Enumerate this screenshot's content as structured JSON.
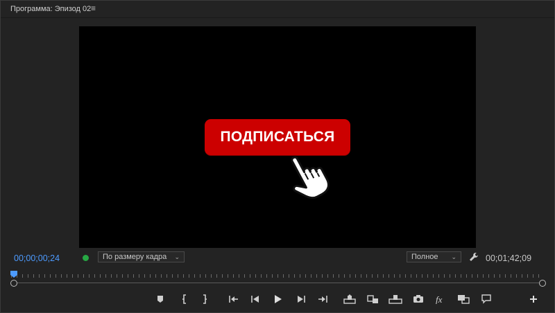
{
  "panel": {
    "title": "Программа: Эпизод 02",
    "menu_icon": "hamburger-menu-icon"
  },
  "viewer": {
    "subscribe_label": "ПОДПИСАТЬСЯ",
    "subscribe_color": "#cc0000",
    "pointer_icon": "hand-pointer-icon"
  },
  "status": {
    "current_timecode": "00;00;00;24",
    "current_timecode_color": "#4d9bff",
    "duration_timecode": "00;01;42;09",
    "fit_dropdown": "По размеру кадра",
    "resolution_dropdown": "Полное",
    "settings_icon": "wrench-icon"
  },
  "transport": {
    "buttons": [
      "add-marker-icon",
      "mark-in-icon",
      "mark-out-icon",
      "go-to-in-icon",
      "step-back-icon",
      "play-icon",
      "step-forward-icon",
      "go-to-out-icon",
      "lift-icon",
      "extract-icon",
      "insert-icon",
      "export-frame-icon",
      "fx-icon",
      "comparison-view-icon",
      "comment-icon",
      "add-button-icon"
    ]
  }
}
